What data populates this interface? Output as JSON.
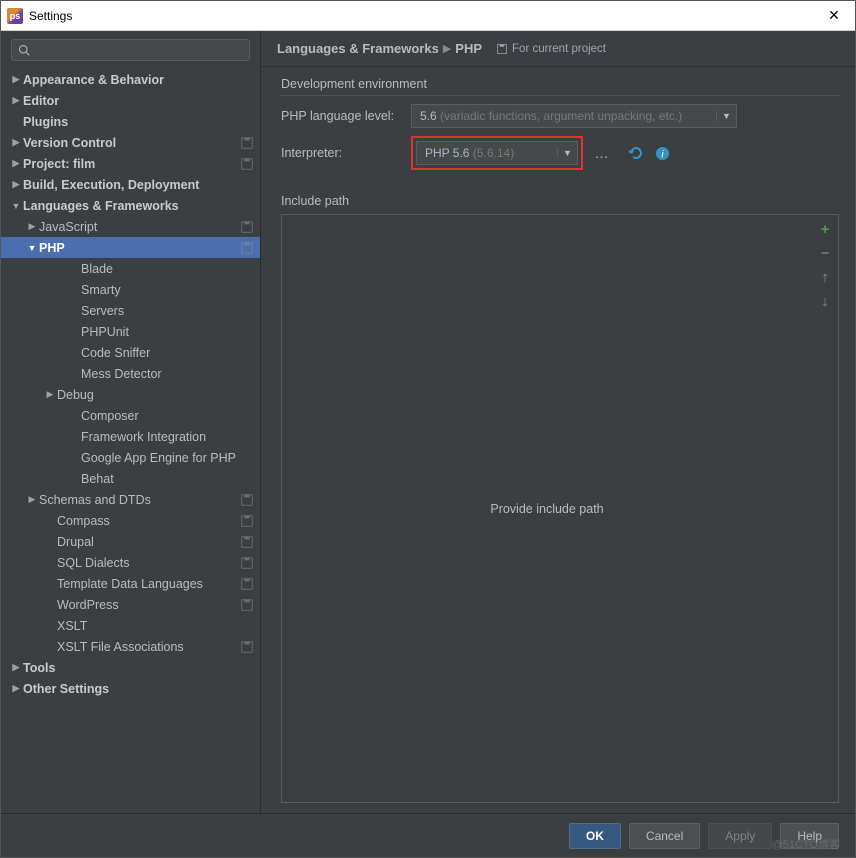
{
  "window": {
    "title": "Settings"
  },
  "breadcrumb": {
    "part1": "Languages & Frameworks",
    "part2": "PHP",
    "project_hint": "For current project"
  },
  "dev_env": {
    "section": "Development environment",
    "lang_label": "PHP language level:",
    "lang_value": "5.6",
    "lang_hint": "(variadic functions, argument unpacking, etc.)",
    "interp_label": "Interpreter:",
    "interp_value": "PHP 5.6",
    "interp_hint": "(5.6.14)"
  },
  "include": {
    "label": "Include path",
    "placeholder": "Provide include path"
  },
  "buttons": {
    "ok": "OK",
    "cancel": "Cancel",
    "apply": "Apply",
    "help": "Help"
  },
  "tree": [
    {
      "label": "Appearance & Behavior",
      "bold": true,
      "arrow": "▶",
      "indent": 0
    },
    {
      "label": "Editor",
      "bold": true,
      "arrow": "▶",
      "indent": 0
    },
    {
      "label": "Plugins",
      "bold": true,
      "arrow": "",
      "indent": 0
    },
    {
      "label": "Version Control",
      "bold": true,
      "arrow": "▶",
      "indent": 0,
      "badge": true
    },
    {
      "label": "Project: film",
      "bold": true,
      "arrow": "▶",
      "indent": 0,
      "badge": true
    },
    {
      "label": "Build, Execution, Deployment",
      "bold": true,
      "arrow": "▶",
      "indent": 0
    },
    {
      "label": "Languages & Frameworks",
      "bold": true,
      "arrow": "▼",
      "indent": 0
    },
    {
      "label": "JavaScript",
      "bold": false,
      "arrow": "▶",
      "indent": 1,
      "badge": true
    },
    {
      "label": "PHP",
      "bold": false,
      "arrow": "▼",
      "indent": 1,
      "selected": true,
      "badge": true
    },
    {
      "label": "Blade",
      "bold": false,
      "arrow": "",
      "indent": 3
    },
    {
      "label": "Smarty",
      "bold": false,
      "arrow": "",
      "indent": 3
    },
    {
      "label": "Servers",
      "bold": false,
      "arrow": "",
      "indent": 3
    },
    {
      "label": "PHPUnit",
      "bold": false,
      "arrow": "",
      "indent": 3
    },
    {
      "label": "Code Sniffer",
      "bold": false,
      "arrow": "",
      "indent": 3
    },
    {
      "label": "Mess Detector",
      "bold": false,
      "arrow": "",
      "indent": 3
    },
    {
      "label": "Debug",
      "bold": false,
      "arrow": "▶",
      "indent": 2
    },
    {
      "label": "Composer",
      "bold": false,
      "arrow": "",
      "indent": 3
    },
    {
      "label": "Framework Integration",
      "bold": false,
      "arrow": "",
      "indent": 3
    },
    {
      "label": "Google App Engine for PHP",
      "bold": false,
      "arrow": "",
      "indent": 3
    },
    {
      "label": "Behat",
      "bold": false,
      "arrow": "",
      "indent": 3
    },
    {
      "label": "Schemas and DTDs",
      "bold": false,
      "arrow": "▶",
      "indent": 1,
      "badge": true
    },
    {
      "label": "Compass",
      "bold": false,
      "arrow": "",
      "indent": 2,
      "badge": true
    },
    {
      "label": "Drupal",
      "bold": false,
      "arrow": "",
      "indent": 2,
      "badge": true
    },
    {
      "label": "SQL Dialects",
      "bold": false,
      "arrow": "",
      "indent": 2,
      "badge": true
    },
    {
      "label": "Template Data Languages",
      "bold": false,
      "arrow": "",
      "indent": 2,
      "badge": true
    },
    {
      "label": "WordPress",
      "bold": false,
      "arrow": "",
      "indent": 2,
      "badge": true
    },
    {
      "label": "XSLT",
      "bold": false,
      "arrow": "",
      "indent": 2
    },
    {
      "label": "XSLT File Associations",
      "bold": false,
      "arrow": "",
      "indent": 2,
      "badge": true
    },
    {
      "label": "Tools",
      "bold": true,
      "arrow": "▶",
      "indent": 0
    },
    {
      "label": "Other Settings",
      "bold": true,
      "arrow": "▶",
      "indent": 0
    }
  ],
  "watermark": "@51CTO博客"
}
